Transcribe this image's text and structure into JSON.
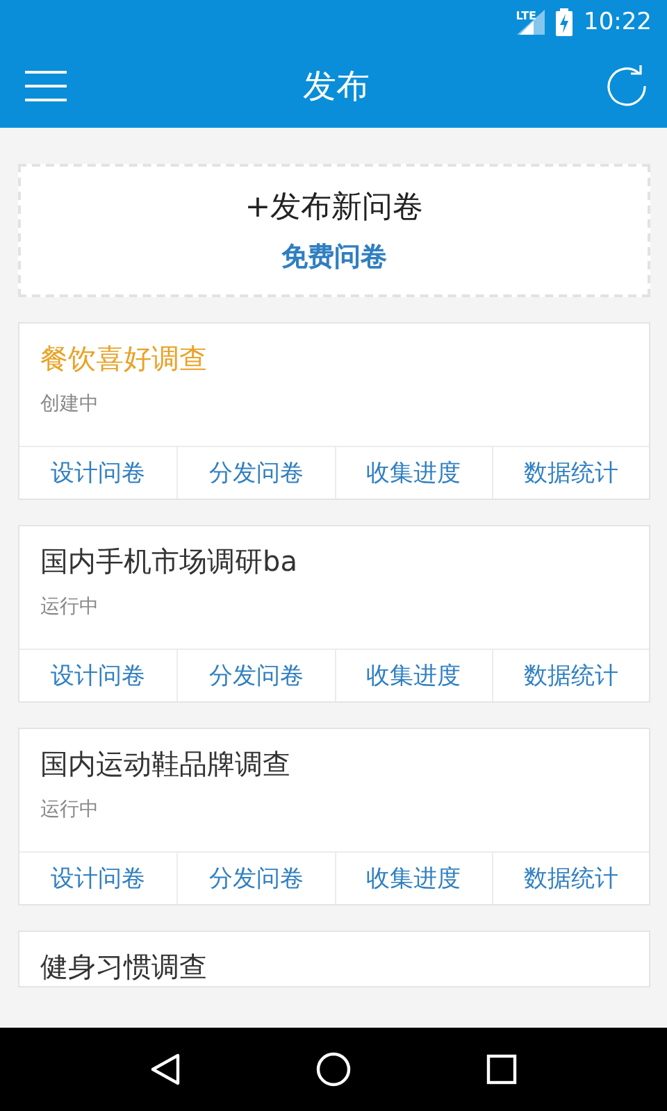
{
  "status_bar": {
    "network": "LTE",
    "time": "10:22"
  },
  "app_bar": {
    "title": "发布"
  },
  "publish": {
    "label": "+发布新问卷",
    "sublabel": "免费问卷"
  },
  "surveys": [
    {
      "title": "餐饮喜好调查",
      "status": "创建中",
      "selected": true,
      "actions": [
        "设计问卷",
        "分发问卷",
        "收集进度",
        "数据统计"
      ]
    },
    {
      "title": "国内手机市场调研ba",
      "status": "运行中",
      "selected": false,
      "actions": [
        "设计问卷",
        "分发问卷",
        "收集进度",
        "数据统计"
      ]
    },
    {
      "title": "国内运动鞋品牌调查",
      "status": "运行中",
      "selected": false,
      "actions": [
        "设计问卷",
        "分发问卷",
        "收集进度",
        "数据统计"
      ]
    },
    {
      "title": "健身习惯调查",
      "selected": false
    }
  ]
}
